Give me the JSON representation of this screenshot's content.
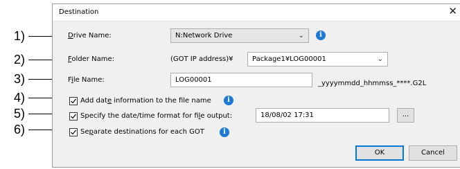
{
  "callouts": [
    "1)",
    "2)",
    "3)",
    "4)",
    "5)",
    "6)"
  ],
  "dialog": {
    "title": "Destination",
    "close_glyph": "✕"
  },
  "drive": {
    "label_prefix": "D",
    "label_rest": "rive Name:",
    "value": "N:Network Drive"
  },
  "folder": {
    "label_prefix": "F",
    "label_rest": "older Name:",
    "prefix_text": "(GOT IP address)¥",
    "value": "Package1¥LOG00001"
  },
  "file": {
    "label_a": "F",
    "label_u": "i",
    "label_b": "le Name:",
    "value": "LOG00001",
    "suffix": "_yyyymmdd_hhmmss_****.G2L"
  },
  "add_date": {
    "label_a": "Add dat",
    "label_u": "e",
    "label_b": " information to the file name",
    "checked": true
  },
  "date_format": {
    "label_a": "Specify the date/time format for fi",
    "label_u": "l",
    "label_b": "e output:",
    "value": "18/08/02 17:31",
    "browse_label": "...",
    "checked": true
  },
  "separate": {
    "label_a": "Se",
    "label_u": "p",
    "label_b": "arate destinations for each GOT",
    "checked": true
  },
  "buttons": {
    "ok": "OK",
    "cancel": "Cancel"
  },
  "icons": {
    "info": "i",
    "chevron": "⌄"
  },
  "colors": {
    "info_blue": "#1e7ad6",
    "default_button_border": "#0078d7"
  }
}
